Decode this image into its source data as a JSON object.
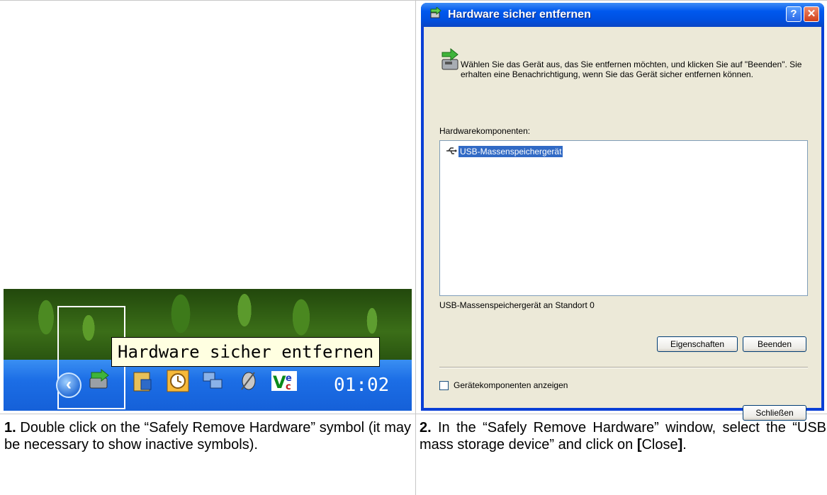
{
  "step1": {
    "tooltip": "Hardware sicher entfernen",
    "clock": "01:02",
    "caption_number": "1.",
    "caption_text": " Double click on the “Safely Remove Hardware” symbol (it may be necessary to show inactive symbols)."
  },
  "step2": {
    "caption_number": "2.",
    "caption_text_before": " In the “Safely Remove Hardware” window, select the “USB mass storage device” and click on ",
    "caption_bold_bracket_open": "[",
    "caption_close": "Close",
    "caption_bold_bracket_close": "]",
    "caption_text_after": "."
  },
  "dialog": {
    "title": "Hardware sicher entfernen",
    "help_button": "?",
    "close_button": "✕",
    "intro": "Wählen Sie das Gerät aus, das Sie entfernen möchten, und klicken Sie auf \"Beenden\". Sie erhalten eine Benachrichtigung, wenn Sie das Gerät sicher entfernen können.",
    "list_label": "Hardwarekomponenten:",
    "list_items": [
      "USB-Massenspeichergerät"
    ],
    "status": "USB-Massenspeichergerät an Standort 0",
    "properties_button": "Eigenschaften",
    "stop_button": "Beenden",
    "checkbox_label": "Gerätekomponenten anzeigen",
    "close_main_button": "Schließen"
  }
}
